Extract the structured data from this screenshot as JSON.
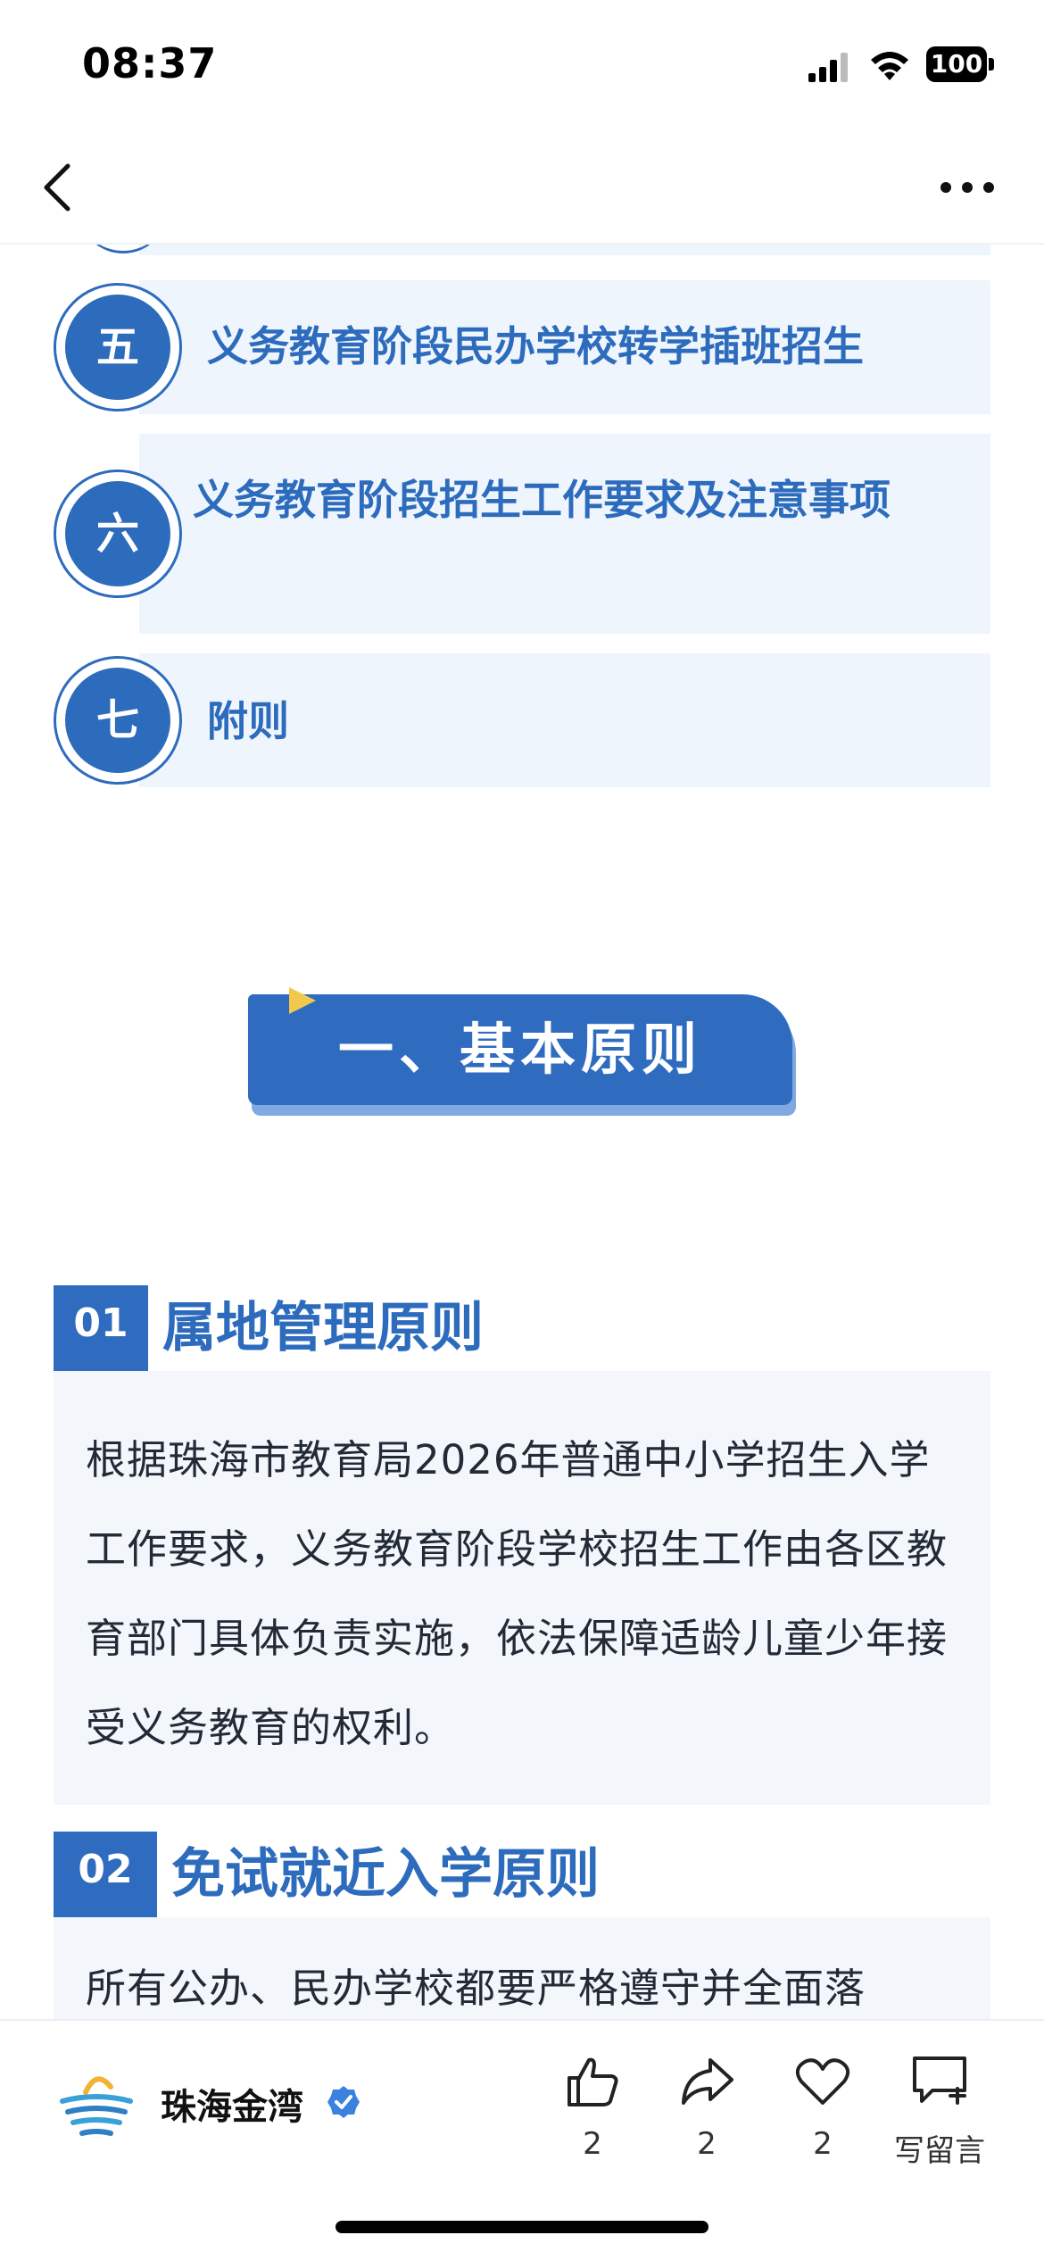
{
  "status_bar": {
    "time": "08:37",
    "battery": "100"
  },
  "toc": [
    {
      "num": "五",
      "label": "义务教育阶段民办学校转学插班招生"
    },
    {
      "num": "六",
      "label": "义务教育阶段招生工作要求及注意事项"
    },
    {
      "num": "七",
      "label": "附则"
    }
  ],
  "section": {
    "title": "一、基本原则"
  },
  "principles": [
    {
      "num": "01",
      "title": "属地管理原则",
      "text": "根据珠海市教育局2026年普通中小学招生入学工作要求，义务教育阶段学校招生工作由各区教育部门具体负责实施，依法保障适龄儿童少年接受义务教育的权利。"
    },
    {
      "num": "02",
      "title": "免试就近入学原则",
      "text": "所有公办、民办学校都要严格遵守并全面落"
    }
  ],
  "bottom_bar": {
    "account_name": "珠海金湾",
    "like_count": "2",
    "share_count": "2",
    "favorite_count": "2",
    "comment_label": "写留言"
  },
  "colors": {
    "accent": "#2f6cbf",
    "panel": "#eef5fd"
  }
}
